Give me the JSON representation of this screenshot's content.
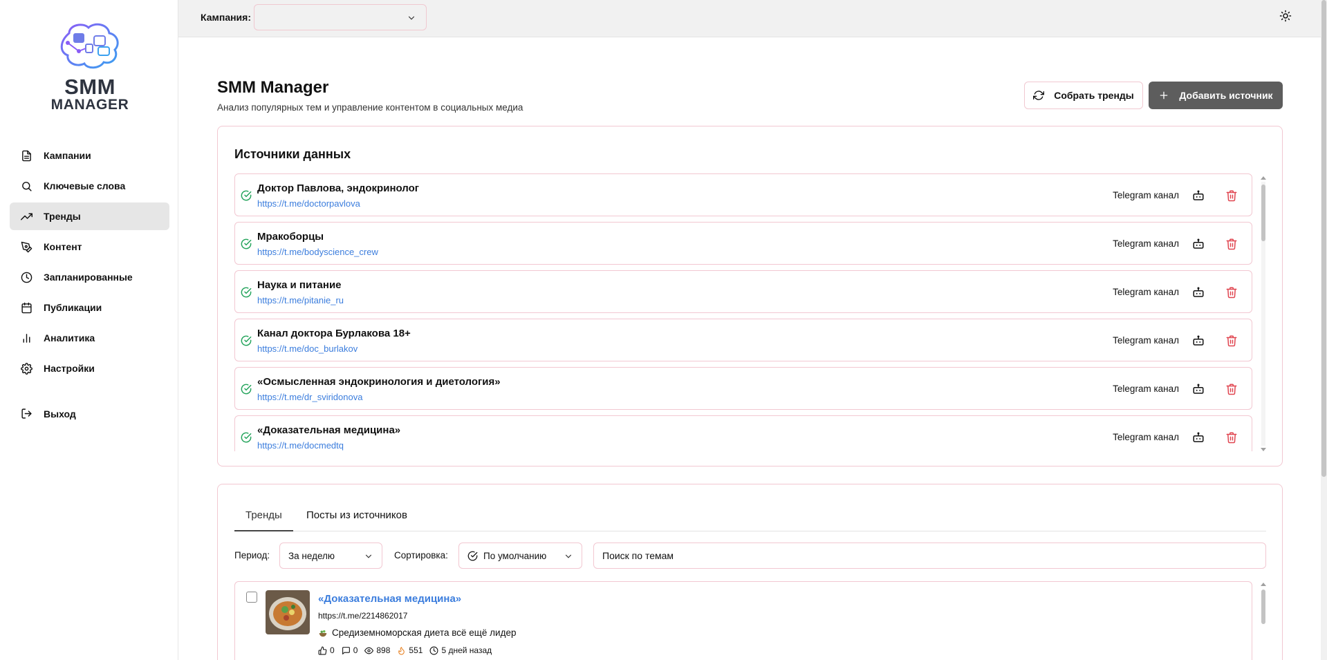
{
  "sidebar": {
    "logo": {
      "line1": "SMM",
      "line2": "MANAGER"
    },
    "items": [
      {
        "label": "Кампании",
        "icon": "file-text-icon",
        "active": false
      },
      {
        "label": "Ключевые слова",
        "icon": "search-icon",
        "active": false
      },
      {
        "label": "Тренды",
        "icon": "trending-up-icon",
        "active": true
      },
      {
        "label": "Контент",
        "icon": "pen-tool-icon",
        "active": false
      },
      {
        "label": "Запланированные",
        "icon": "clock-icon",
        "active": false
      },
      {
        "label": "Публикации",
        "icon": "calendar-icon",
        "active": false
      },
      {
        "label": "Аналитика",
        "icon": "bar-chart-icon",
        "active": false
      },
      {
        "label": "Настройки",
        "icon": "gear-icon",
        "active": false
      }
    ],
    "logout_label": "Выход"
  },
  "topbar": {
    "campaign_label": "Кампания:",
    "campaign_value": ""
  },
  "header": {
    "title": "SMM Manager",
    "subtitle": "Анализ популярных тем и управление контентом в социальных медиа",
    "collect_trends_label": "Собрать тренды",
    "add_source_label": "Добавить источник"
  },
  "sources": {
    "title": "Источники данных",
    "items": [
      {
        "name": "Доктор Павлова, эндокринолог",
        "url": "https://t.me/doctorpavlova",
        "type": "Telegram канал"
      },
      {
        "name": "Мракоборцы",
        "url": "https://t.me/bodyscience_crew",
        "type": "Telegram канал"
      },
      {
        "name": "Наука и питание",
        "url": "https://t.me/pitanie_ru",
        "type": "Telegram канал"
      },
      {
        "name": "Канал доктора Бурлакова 18+",
        "url": "https://t.me/doc_burlakov",
        "type": "Telegram канал"
      },
      {
        "name": "«Осмысленная эндокринология и диетология»",
        "url": "https://t.me/dr_sviridonova",
        "type": "Telegram канал"
      },
      {
        "name": "«Доказательная медицина»",
        "url": "https://t.me/docmedtq",
        "type": "Telegram канал"
      }
    ]
  },
  "trends": {
    "tabs": [
      {
        "label": "Тренды",
        "active": true
      },
      {
        "label": "Посты из источников",
        "active": false
      }
    ],
    "period_label": "Период:",
    "period_value": "За неделю",
    "sort_label": "Сортировка:",
    "sort_value": "По умолчанию",
    "search_value": "Поиск по темам",
    "posts": [
      {
        "title": "«Доказательная медицина»",
        "url": "https://t.me/2214862017",
        "text": "Средиземноморская диета всё ещё лидер",
        "likes": "0",
        "comments": "0",
        "views": "898",
        "score": "551",
        "age": "5 дней назад"
      }
    ]
  },
  "colors": {
    "accent_link": "#3b7ddd",
    "border_pink": "#f2c7d1",
    "dark_button": "#5d5d5d",
    "active_nav": "#e6e6e6",
    "check_green": "#22a35a",
    "delete_red": "#e0444f"
  }
}
